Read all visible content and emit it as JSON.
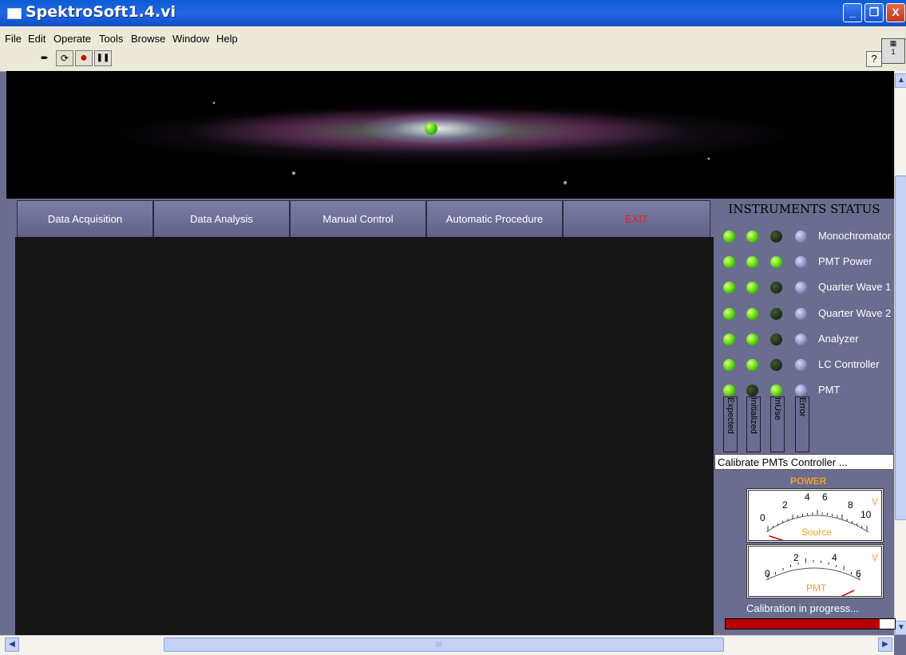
{
  "window": {
    "title": "SpektroSoft1.4.vi",
    "min": "_",
    "max": "❐",
    "close": "X"
  },
  "menu": [
    "File",
    "Edit",
    "Operate",
    "Tools",
    "Browse",
    "Window",
    "Help"
  ],
  "toolbar": {
    "run": "➨",
    "run_cont": "⟳",
    "abort": "●",
    "pause": "❚❚",
    "help": "?"
  },
  "tabs": [
    "Data Acquisition",
    "Data Analysis",
    "Manual Control",
    "Automatic Procedure",
    "EXIT"
  ],
  "colors": {
    "exit_text": "#e02020",
    "power_label": "#f0a02a"
  },
  "instruments": {
    "title": "INSTRUMENTS STATUS",
    "items": [
      {
        "name": "Monochromator",
        "expected": true,
        "initialized": true,
        "in_use": false,
        "error": false
      },
      {
        "name": "PMT Power",
        "expected": true,
        "initialized": true,
        "in_use": true,
        "error": false
      },
      {
        "name": "Quarter Wave 1",
        "expected": true,
        "initialized": true,
        "in_use": false,
        "error": false
      },
      {
        "name": "Quarter Wave 2",
        "expected": true,
        "initialized": true,
        "in_use": false,
        "error": false
      },
      {
        "name": "Analyzer",
        "expected": true,
        "initialized": true,
        "in_use": false,
        "error": false
      },
      {
        "name": "LC Controller",
        "expected": true,
        "initialized": true,
        "in_use": false,
        "error": false
      },
      {
        "name": "PMT",
        "expected": true,
        "initialized": false,
        "in_use": true,
        "error": false
      }
    ],
    "columns": [
      "Expected",
      "Initialized",
      "InUse",
      "Error"
    ]
  },
  "calibration": {
    "status": "Calibrate PMTs Controller ...",
    "power_label": "POWER",
    "source_meter": {
      "label": "Source",
      "unit": "V",
      "ticks": [
        "0",
        "2",
        "4",
        "6",
        "8",
        "10"
      ],
      "value": 0
    },
    "pmt_meter": {
      "label": "PMT",
      "unit": "V",
      "ticks": [
        "0",
        "2",
        "4",
        "6"
      ],
      "value": 5.7
    },
    "message": "Calibration in progress...",
    "progress": 0.91
  },
  "hscroll_grip": "III"
}
